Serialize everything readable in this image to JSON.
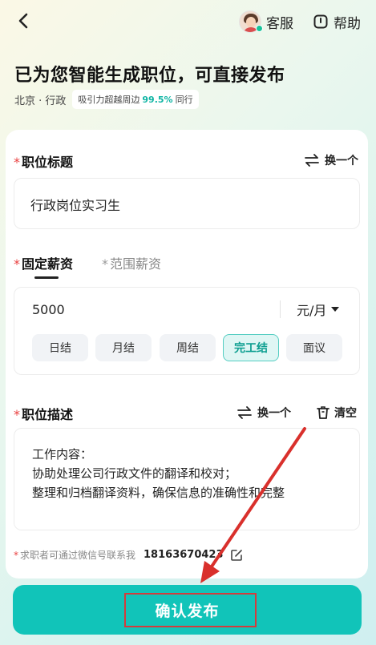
{
  "header": {
    "service_label": "客服",
    "help_label": "帮助"
  },
  "intro": {
    "headline": "已为您智能生成职位，可直接发布",
    "location": "北京 · 行政",
    "attract_prefix": "吸引力超越周边",
    "attract_percent": "99.5%",
    "attract_suffix": "同行"
  },
  "title_section": {
    "required_mark": "*",
    "label": "职位标题",
    "refresh_label": "换一个",
    "value": "行政岗位实习生"
  },
  "salary_section": {
    "tab_fixed": "固定薪资",
    "tab_range": "范围薪资",
    "required_mark": "*",
    "amount": "5000",
    "unit": "元/月",
    "settlement_options": [
      "日结",
      "月结",
      "周结",
      "完工结",
      "面议"
    ],
    "selected_option": "完工结"
  },
  "description_section": {
    "required_mark": "*",
    "label": "职位描述",
    "refresh_label": "换一个",
    "clear_label": "清空",
    "text": "工作内容：\n协助处理公司行政文件的翻译和校对；\n整理和归档翻译资料，确保信息的准确性和完整"
  },
  "contact": {
    "required_mark": "*",
    "label": "求职者可通过微信号联系我",
    "phone": "18163670423"
  },
  "publish": {
    "label": "确认发布"
  },
  "colors": {
    "accent": "#11c4b9",
    "required": "#e94040",
    "annotation": "#d33c3c"
  }
}
